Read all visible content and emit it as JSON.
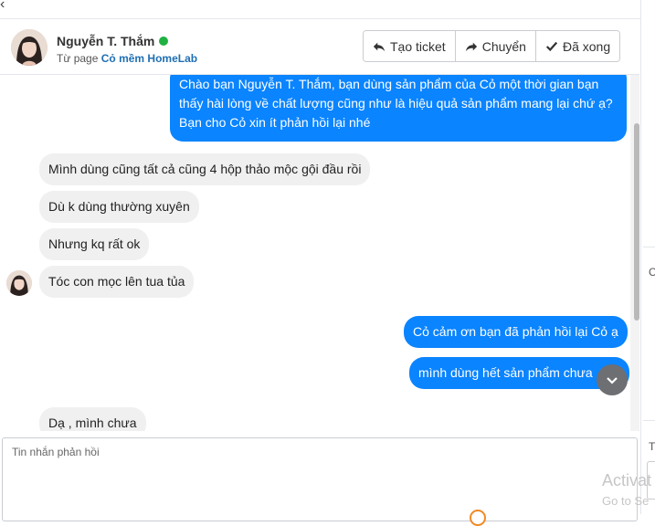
{
  "header": {
    "name": "Nguyễn T. Thắm",
    "page_prefix": "Từ page",
    "page_name": "Cỏ mềm HomeLab",
    "buttons": {
      "create_ticket": "Tạo ticket",
      "transfer": "Chuyển",
      "done": "Đã xong"
    }
  },
  "messages": {
    "out_1": "Chào bạn Nguyễn T. Thắm, bạn dùng sản phẩm của Cỏ một thời gian bạn thấy hài lòng về chất lượng cũng như là hiệu quả sản phẩm mang lại chứ ạ? Bạn cho Cỏ xin ít phản hồi lại nhé",
    "in_1": "Mình dùng cũng tất cả cũng 4 hộp thảo mộc gội đầu rồi",
    "in_2": "Dù k dùng thường xuyên",
    "in_3": "Nhưng kq rất ok",
    "in_4": "Tóc con mọc lên tua tủa",
    "out_2": "Cỏ cảm ơn bạn đã phản hồi lại Cỏ ạ",
    "out_3": "mình dùng hết sản phẩm chưa",
    "in_5": "Dạ , mình chưa"
  },
  "composer": {
    "placeholder": "Tin nhắn phản hồi"
  },
  "side_panel": {
    "c_label": "C",
    "t_label": "T"
  },
  "watermark": {
    "line1": "Activat",
    "line2": "Go to Se"
  },
  "colors": {
    "outgoing_bubble": "#0a84ff",
    "incoming_bubble": "#f0f0f0",
    "online": "#1fb141",
    "link": "#1f6fb3"
  }
}
